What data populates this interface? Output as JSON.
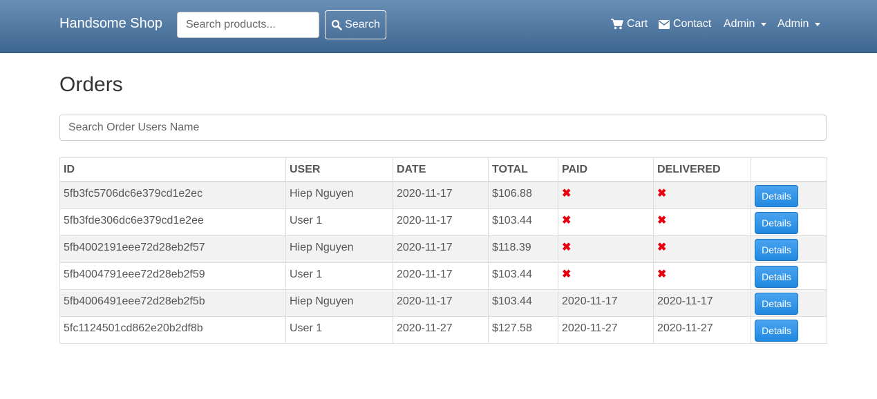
{
  "navbar": {
    "brand": "Handsome Shop",
    "search_placeholder": "Search products...",
    "search_button": "Search",
    "cart": "Cart",
    "contact": "Contact",
    "admin_menu_1": "Admin",
    "admin_menu_2": "Admin"
  },
  "page": {
    "title": "Orders",
    "search_placeholder": "Search Order Users Name"
  },
  "table": {
    "headers": [
      "ID",
      "USER",
      "DATE",
      "TOTAL",
      "PAID",
      "DELIVERED",
      ""
    ],
    "details_label": "Details",
    "rows": [
      {
        "id": "5fb3fc5706dc6e379cd1e2ec",
        "user": "Hiep Nguyen",
        "date": "2020-11-17",
        "total": "$106.88",
        "paid": "✖",
        "delivered": "✖"
      },
      {
        "id": "5fb3fde306dc6e379cd1e2ee",
        "user": "User 1",
        "date": "2020-11-17",
        "total": "$103.44",
        "paid": "✖",
        "delivered": "✖"
      },
      {
        "id": "5fb4002191eee72d28eb2f57",
        "user": "Hiep Nguyen",
        "date": "2020-11-17",
        "total": "$118.39",
        "paid": "✖",
        "delivered": "✖"
      },
      {
        "id": "5fb4004791eee72d28eb2f59",
        "user": "User 1",
        "date": "2020-11-17",
        "total": "$103.44",
        "paid": "✖",
        "delivered": "✖"
      },
      {
        "id": "5fb4006491eee72d28eb2f5b",
        "user": "Hiep Nguyen",
        "date": "2020-11-17",
        "total": "$103.44",
        "paid": "2020-11-17",
        "delivered": "2020-11-17"
      },
      {
        "id": "5fc1124501cd862e20b2df8b",
        "user": "User 1",
        "date": "2020-11-27",
        "total": "$127.58",
        "paid": "2020-11-27",
        "delivered": "2020-11-27"
      }
    ]
  },
  "colors": {
    "navbar_top": "#6a8fb6",
    "navbar_bottom": "#3d6690",
    "not_done_mark": "#e8000e",
    "details_button": "#2189e0",
    "striped_row": "#f2f2f2"
  },
  "icons": {
    "search": "search-icon",
    "cart": "cart-icon",
    "contact": "envelope-icon",
    "dropdown": "caret-down-icon",
    "not_done": "x-mark-icon"
  }
}
